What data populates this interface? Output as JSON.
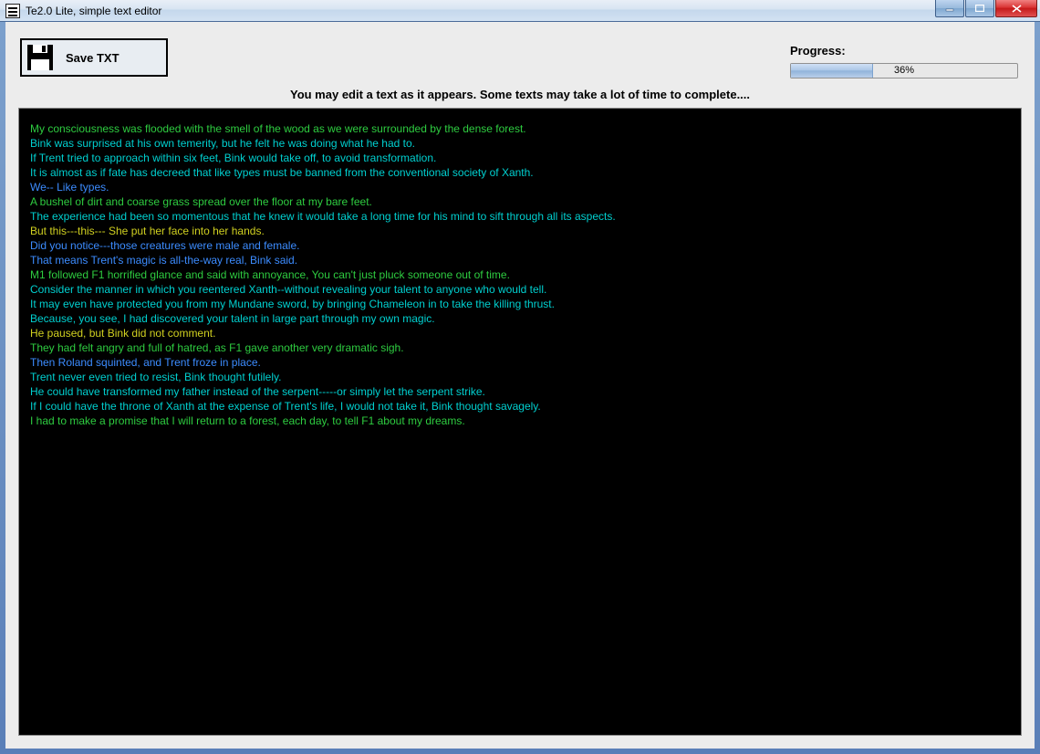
{
  "window": {
    "title": "Te2.0 Lite, simple text editor"
  },
  "toolbar": {
    "save_label": "Save TXT"
  },
  "progress": {
    "label": "Progress:",
    "percent": 36,
    "text": "36%"
  },
  "banner": "You may edit a text as it appears. Some texts may take a lot of time to complete....",
  "colors": {
    "green": "#2ecc40",
    "cyan": "#00d0d0",
    "blue": "#3c8cff",
    "yellow": "#d0d020"
  },
  "lines": [
    {
      "color": "green",
      "text": "My consciousness was flooded with the smell of the wood as we were surrounded by the dense forest."
    },
    {
      "color": "cyan",
      "text": "Bink was surprised at his own temerity, but he felt he was doing what he had to."
    },
    {
      "color": "cyan",
      "text": "If Trent tried to approach within six feet, Bink would take off, to avoid transformation."
    },
    {
      "color": "cyan",
      "text": "It is almost as if fate has decreed that like types must be banned from the conventional society of Xanth."
    },
    {
      "color": "blue",
      "text": "We-- Like types."
    },
    {
      "color": "green",
      "text": "A bushel of dirt and coarse grass spread over the floor at my bare feet."
    },
    {
      "color": "cyan",
      "text": "The experience had been so momentous that he knew it would take a long time for his mind to sift through all its aspects."
    },
    {
      "color": "yellow",
      "text": "But this---this--- She put her face into her hands."
    },
    {
      "color": "blue",
      "text": "Did you notice---those creatures were male and female."
    },
    {
      "color": "blue",
      "text": "That means Trent's magic is all-the-way real, Bink said."
    },
    {
      "color": "green",
      "text": "M1 followed F1 horrified glance and said with annoyance, You can't just pluck someone out of time."
    },
    {
      "color": "cyan",
      "text": "Consider the manner in which you reentered Xanth--without revealing your talent to anyone who would tell."
    },
    {
      "color": "cyan",
      "text": "It may even have protected you from my Mundane sword, by bringing Chameleon in to take the killing thrust."
    },
    {
      "color": "cyan",
      "text": "Because, you see, I had discovered your talent in large part through my own magic."
    },
    {
      "color": "yellow",
      "text": "He paused, but Bink did not comment."
    },
    {
      "color": "green",
      "text": "They had felt angry and full of hatred, as F1 gave another very dramatic sigh."
    },
    {
      "color": "blue",
      "text": "Then Roland squinted, and Trent froze in place."
    },
    {
      "color": "cyan",
      "text": "Trent never even tried to resist, Bink thought futilely."
    },
    {
      "color": "cyan",
      "text": "He could have transformed my father instead of the serpent-----or simply let the serpent strike."
    },
    {
      "color": "cyan",
      "text": "If I could have the throne of Xanth at the expense of Trent's life, I would not take it, Bink thought savagely."
    },
    {
      "color": "green",
      "text": "I had to make a promise that I will return to a forest, each day, to tell F1 about my dreams."
    }
  ]
}
